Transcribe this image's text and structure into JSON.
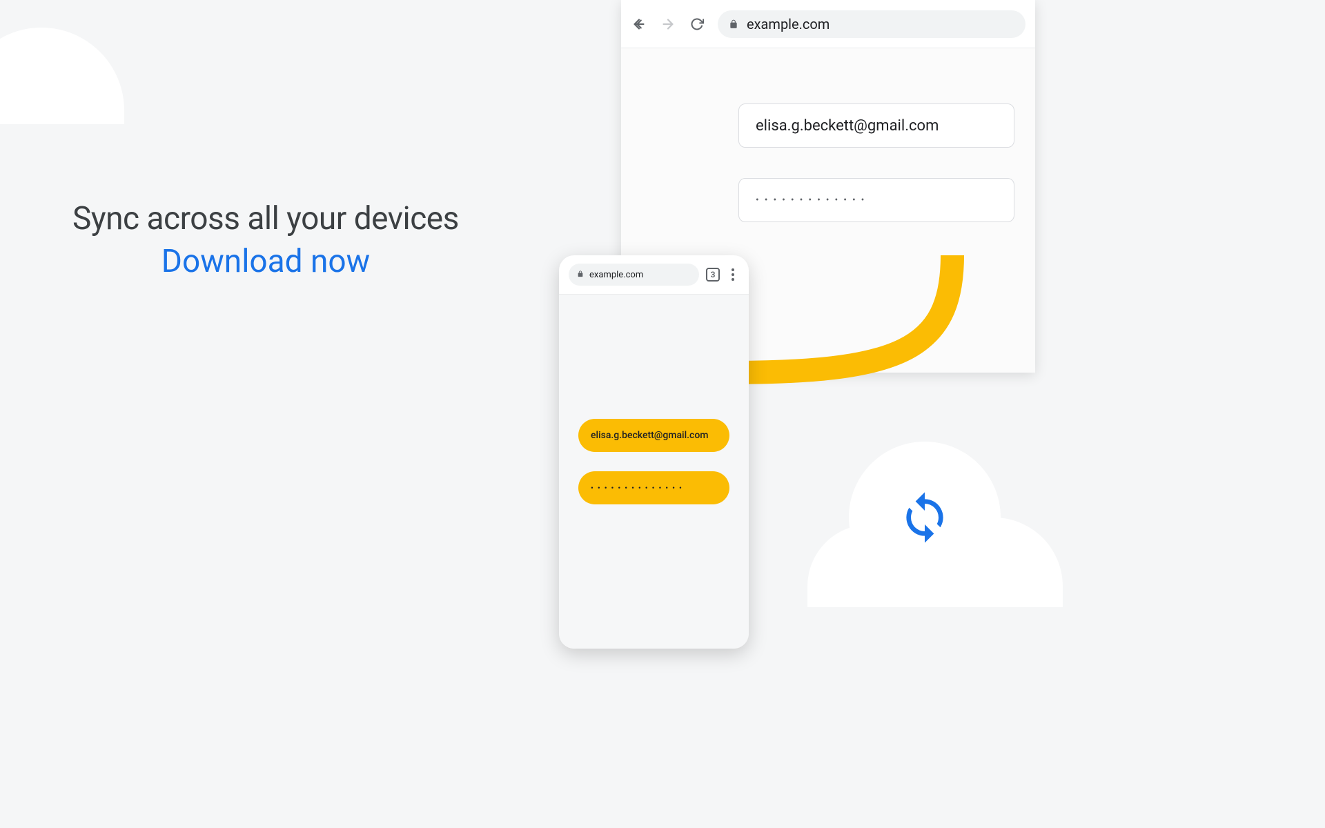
{
  "headline": {
    "title": "Sync across all your devices",
    "cta": "Download now"
  },
  "desktop": {
    "url": "example.com",
    "email": "elisa.g.beckett@gmail.com",
    "password_mask": "•••••••••••••"
  },
  "mobile": {
    "url": "example.com",
    "tab_count": "3",
    "email": "elisa.g.beckett@gmail.com",
    "password_mask": "••••••••••••••"
  },
  "colors": {
    "accent_blue": "#1a73e8",
    "accent_yellow": "#fbbc04",
    "text_primary": "#3c4043"
  }
}
